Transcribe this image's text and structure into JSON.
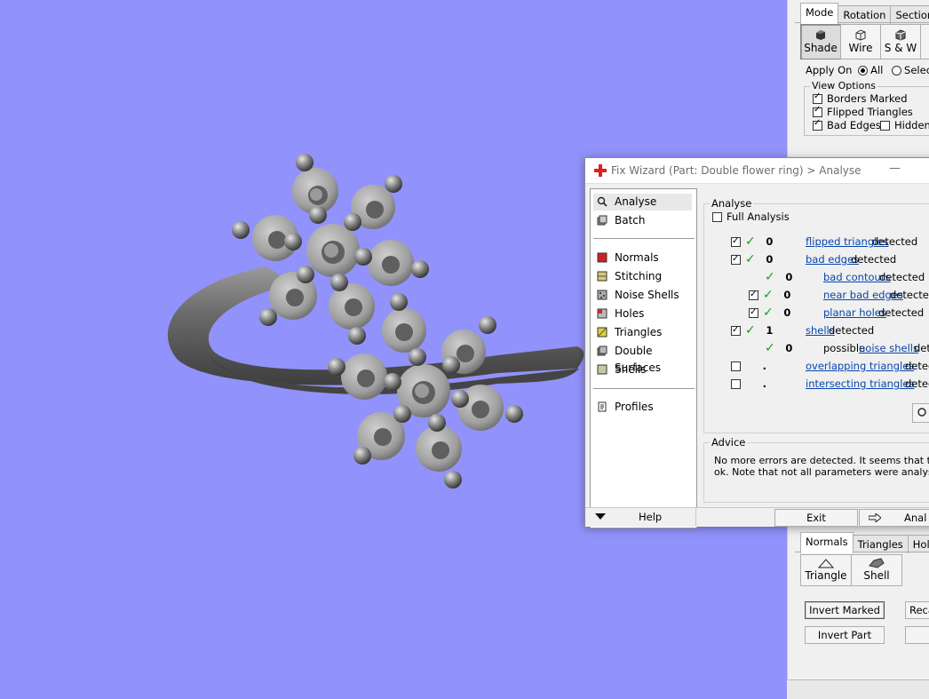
{
  "side_panel": {
    "mode_tabs": [
      "Mode",
      "Rotation",
      "Section"
    ],
    "view_buttons": [
      {
        "label": "Shade",
        "icon": "shade-cube-icon",
        "active": true
      },
      {
        "label": "Wire",
        "icon": "wire-cube-icon",
        "active": false
      },
      {
        "label": "S & W",
        "icon": "shade-wire-cube-icon",
        "active": false
      }
    ],
    "apply_on": {
      "label": "Apply On",
      "options": [
        "All",
        "Selection"
      ],
      "selected": "All"
    },
    "view_options": {
      "legend": "View Options",
      "items": [
        {
          "label": "Borders Marked",
          "checked": true
        },
        {
          "label": "Flipped Triangles",
          "checked": true
        },
        {
          "label": "Bad Edges",
          "checked": true
        },
        {
          "label": "Hidden L",
          "checked": false
        }
      ]
    },
    "fix_tabs": [
      "Normals",
      "Triangles",
      "Holes"
    ],
    "fix_buttons": [
      {
        "label": "Triangle",
        "icon": "triangle-icon"
      },
      {
        "label": "Shell",
        "icon": "shell-icon"
      }
    ],
    "actions": {
      "invert_marked": "Invert Marked",
      "recalc": "Reca",
      "invert_part": "Invert Part"
    }
  },
  "dialog": {
    "title": "Fix Wizard (Part: Double flower ring) > Analyse",
    "minimize": "—",
    "nav": [
      {
        "label": "Analyse",
        "icon": "magnifier-icon",
        "selected": true
      },
      {
        "label": "Batch",
        "icon": "batch-icon",
        "selected": false
      },
      {
        "label": "Normals",
        "icon": "normals-icon",
        "selected": false,
        "color": "#d02020"
      },
      {
        "label": "Stitching",
        "icon": "stitching-icon",
        "selected": false,
        "color": "#d8c870"
      },
      {
        "label": "Noise Shells",
        "icon": "noise-shells-icon",
        "selected": false
      },
      {
        "label": "Holes",
        "icon": "holes-icon",
        "selected": false,
        "color": "#c03030"
      },
      {
        "label": "Triangles",
        "icon": "triangles-icon",
        "selected": false,
        "color": "#e0d040"
      },
      {
        "label": "Double Surfaces",
        "icon": "double-surfaces-icon",
        "selected": false
      },
      {
        "label": "Shells",
        "icon": "shells-icon",
        "selected": false
      },
      {
        "label": "Profiles",
        "icon": "profiles-icon",
        "selected": false
      }
    ],
    "analyse": {
      "legend": "Analyse",
      "full_analysis": "Full Analysis",
      "rows": [
        {
          "checkbox": true,
          "ok": true,
          "count": "0",
          "link": "flipped triangles",
          "suffix": " detected"
        },
        {
          "checkbox": true,
          "ok": true,
          "count": "0",
          "link": "bad edges",
          "suffix": " detected"
        },
        {
          "checkbox": null,
          "ok": true,
          "count": "0",
          "link": "bad contours",
          "suffix": " detected"
        },
        {
          "checkbox": true,
          "ok": true,
          "count": "0",
          "link": "near bad edges",
          "suffix": " detecte"
        },
        {
          "checkbox": true,
          "ok": true,
          "count": "0",
          "link": "planar holes",
          "suffix": " detected"
        },
        {
          "checkbox": true,
          "ok": true,
          "count": "1",
          "link": "shells",
          "suffix": " detected"
        },
        {
          "checkbox": null,
          "ok": true,
          "count": "0",
          "prefix": "possible ",
          "link": "noise shells",
          "suffix": " dete"
        },
        {
          "checkbox": false,
          "ok": false,
          "count": ".",
          "link": "overlapping triangles",
          "suffix": " detecte"
        },
        {
          "checkbox": false,
          "ok": false,
          "count": ".",
          "link": "intersecting triangles",
          "suffix": " detecte"
        }
      ]
    },
    "advice": {
      "legend": "Advice",
      "line1": "No more errors are detected. It seems that the pa",
      "line2": "ok. Note that not all parameters were analysed."
    },
    "footer": {
      "help": "Help",
      "exit": "Exit",
      "analyse": "Anal"
    }
  },
  "colors": {
    "viewport_bg": "#9292fc",
    "ok_green": "#18a018",
    "link_blue": "#0645ad"
  }
}
